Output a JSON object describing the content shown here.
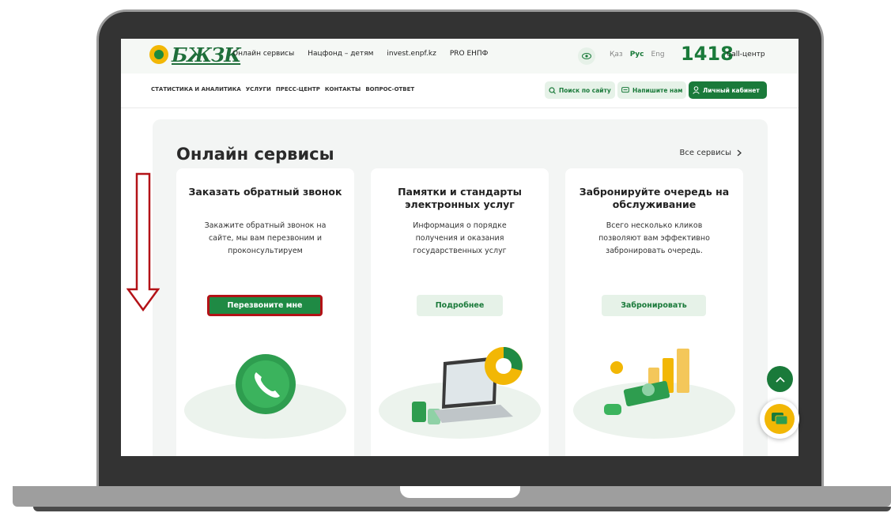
{
  "header": {
    "logo_text": "БЖЗК",
    "top_nav": [
      "Онлайн сервисы",
      "Нацфонд – детям",
      "invest.enpf.kz",
      "PRO ЕНПФ"
    ],
    "languages": [
      "Қаз",
      "Рус",
      "Eng"
    ],
    "active_language": "Рус",
    "call_number": "1418",
    "call_label": "Call-центр",
    "main_nav": [
      "СТАТИСТИКА И АНАЛИТИКА",
      "УСЛУГИ",
      "ПРЕСС-ЦЕНТР",
      "КОНТАКТЫ",
      "ВОПРОС-ОТВЕТ"
    ],
    "search_label": "Поиск по сайту",
    "write_label": "Напишите нам",
    "cabinet_label": "Личный кабинет"
  },
  "section": {
    "title": "Онлайн сервисы",
    "all_services_label": "Все сервисы"
  },
  "cards": [
    {
      "title": "Заказать обратный звонок",
      "description": "Закажите обратный звонок на сайте, мы вам перезвоним и проконсультируем",
      "button": "Перезвоните мне",
      "illustration": "phone-icon"
    },
    {
      "title": "Памятки и стандарты электронных услуг",
      "description": "Информация о порядке получения и оказания государственных услуг",
      "button": "Подробнее",
      "illustration": "laptop-chart-icon"
    },
    {
      "title": "Забронируйте очередь на обслуживание",
      "description": "Всего несколько кликов позволяют вам эффективно забронировать очередь.",
      "button": "Забронировать",
      "illustration": "money-stack-icon"
    }
  ],
  "colors": {
    "brand_green": "#1a7a3a",
    "accent_yellow": "#f2b705",
    "annotation_red": "#b31217"
  }
}
